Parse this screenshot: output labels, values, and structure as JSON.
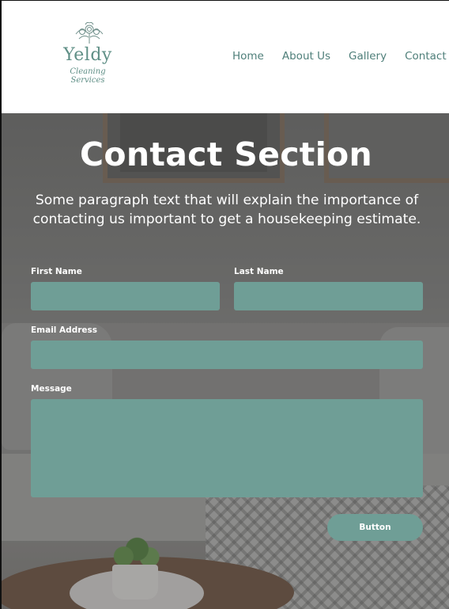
{
  "brand": {
    "name": "Yeldy",
    "tagline": "Cleaning Services"
  },
  "nav": {
    "items": [
      "Home",
      "About Us",
      "Gallery",
      "Contact"
    ]
  },
  "hero": {
    "title": "Contact Section",
    "text": "Some paragraph text that will explain the importance of contacting us important to get a housekeeping estimate."
  },
  "form": {
    "first_name": {
      "label": "First Name",
      "value": ""
    },
    "last_name": {
      "label": "Last Name",
      "value": ""
    },
    "email": {
      "label": "Email Address",
      "value": ""
    },
    "message": {
      "label": "Message",
      "value": ""
    },
    "submit_label": "Button"
  },
  "colors": {
    "accent": "#6f9e96",
    "brand_text": "#5f8f86",
    "nav_text": "#4f7f7a"
  }
}
